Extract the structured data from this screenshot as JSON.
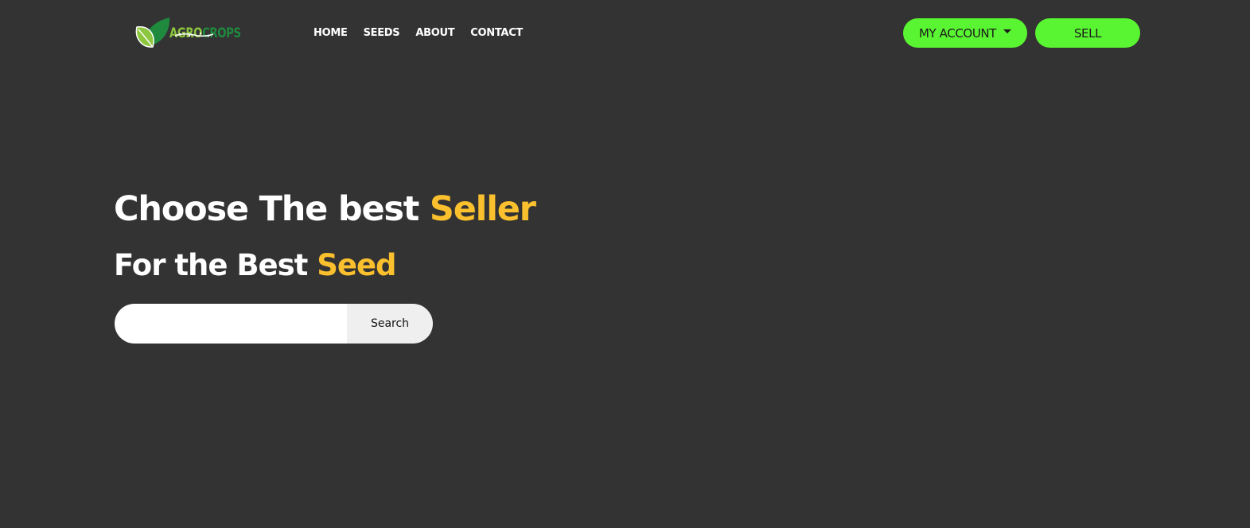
{
  "header": {
    "logo": {
      "word_part1": "AGRO",
      "word_part2": "CROPS",
      "icon": "leaf-icon"
    },
    "nav": [
      {
        "label": "HOME"
      },
      {
        "label": "SEEDS"
      },
      {
        "label": "ABOUT"
      },
      {
        "label": "CONTACT"
      }
    ],
    "account_button": {
      "label": "MY ACCOUNT",
      "icon": "caret-down-icon"
    },
    "sell_button": {
      "label": "SELL"
    }
  },
  "hero": {
    "title_prefix": "Choose The best ",
    "title_accent": "Seller",
    "subtitle_prefix": "For the Best ",
    "subtitle_accent": "Seed"
  },
  "search": {
    "value": "",
    "placeholder": "",
    "button_label": "Search"
  },
  "colors": {
    "background": "#333333",
    "primary_green": "#5af532",
    "accent_yellow": "#fbc02d",
    "logo_light_green": "#8dc63f",
    "logo_dark_green": "#1f8a3e"
  }
}
